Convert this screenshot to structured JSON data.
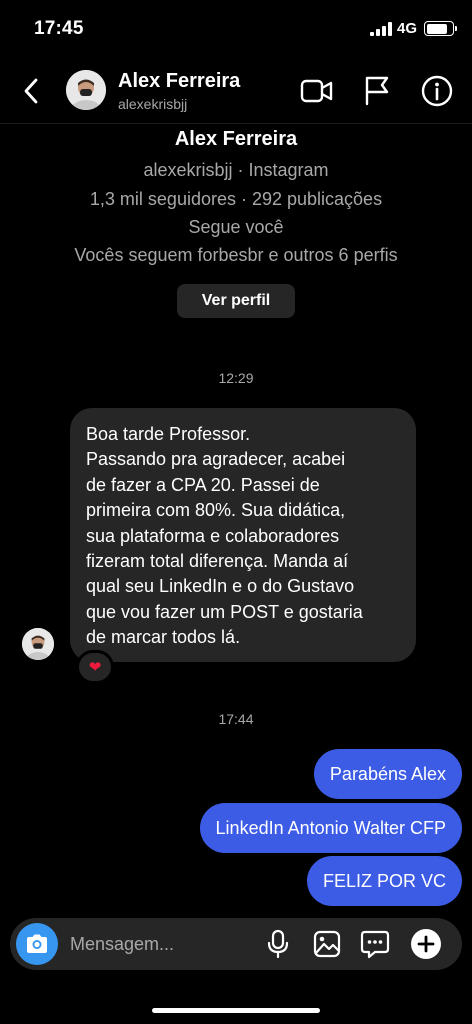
{
  "status_bar": {
    "time": "17:45",
    "network": "4G"
  },
  "header": {
    "name": "Alex Ferreira",
    "username": "alexekrisbjj",
    "icons": [
      "chevron-left-icon",
      "video-camera-icon",
      "flag-icon",
      "info-icon"
    ]
  },
  "profile": {
    "name": "Alex Ferreira",
    "handle_line": "alexekrisbjj · Instagram",
    "stats_line": "1,3 mil seguidores · 292 publicações",
    "follows_you": "Segue você",
    "mutuals": "Vocês seguem forbesbr e outros 6 perfis",
    "view_profile_label": "Ver perfil"
  },
  "messages": {
    "time_1": "12:29",
    "incoming_text": "Boa tarde Professor.\nPassando pra agradecer, acabei\nde fazer a CPA 20. Passei de\nprimeira com 80%. Sua didática,\nsua plataforma e colaboradores\nfizeram total diferença. Manda aí\nqual seu LinkedIn e o do Gustavo\nque vou fazer um POST e gostaria\nde marcar todos lá.",
    "reaction": "❤",
    "time_2": "17:44",
    "outgoing": [
      "Parabéns Alex",
      "LinkedIn Antonio Walter CFP",
      "FELIZ POR VC"
    ]
  },
  "composer": {
    "placeholder": "Mensagem...",
    "icons": [
      "camera-icon",
      "microphone-icon",
      "gallery-icon",
      "sticker-icon",
      "plus-icon"
    ]
  },
  "colors": {
    "background": "#000000",
    "incoming_bubble": "#262626",
    "outgoing_bubble": "#3d5ce6",
    "camera_button": "#3797f0",
    "secondary_text": "#a8a8a8"
  }
}
